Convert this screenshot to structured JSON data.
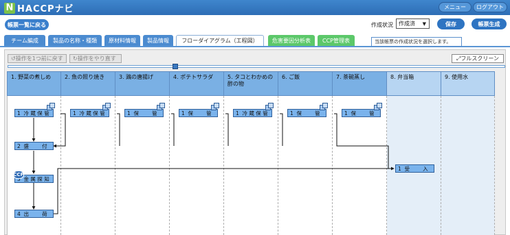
{
  "header": {
    "logo_mark": "N",
    "logo_text": "HACCPナビ",
    "menu_label": "メニュー",
    "logout_label": "ログアウト"
  },
  "subbar": {
    "back_label": "帳票一覧に戻る",
    "status_label": "作成状況",
    "status_value": "作成済",
    "save_label": "保存",
    "generate_label": "帳票生成",
    "tooltip": "当該帳票の作成状況を選択します。"
  },
  "tabs": [
    {
      "label": "チーム編成"
    },
    {
      "label": "製品の名称・種類"
    },
    {
      "label": "原材料情報"
    },
    {
      "label": "製品情報"
    },
    {
      "label": "フローダイアグラム（工程図）"
    },
    {
      "label": "危害要因分析表"
    },
    {
      "label": "CCP管理表"
    }
  ],
  "toolbar": {
    "undo_label": "操作を1つ前に戻す",
    "redo_label": "操作をやり直す",
    "fullscreen_label": "フルスクリーン"
  },
  "columns": [
    {
      "label": "1. 野菜の煮しめ"
    },
    {
      "label": "2. 魚の照り焼き"
    },
    {
      "label": "3. 鶏の唐揚げ"
    },
    {
      "label": "4. ポテトサラダ"
    },
    {
      "label": "5. タコとわかめの酢の物"
    },
    {
      "label": "6. ご飯"
    },
    {
      "label": "7. 茶碗蒸し"
    },
    {
      "label": "8. 弁当箱"
    },
    {
      "label": "9. 使用水"
    }
  ],
  "nodes": {
    "c1_storage": "1  冷 蔵 保 管",
    "c2_storage": "1  冷 蔵 保 管",
    "c3_storage": "1  保        管",
    "c4_storage": "1  保        管",
    "c5_storage": "1  冷 蔵 保 管",
    "c6_storage": "1  保        管",
    "c7_storage": "1  保        管",
    "c1_fill": "2  盛        付",
    "c1_metal": "3  金 属 探 知",
    "c1_ship": "4  出        荷",
    "c8_receive": "1  受        入"
  },
  "ccp_badge": "CCP",
  "colors": {
    "header": "#2d6db5",
    "column_dark": "#7ab0e4",
    "column_light": "#b7d5f2",
    "node": "#7ab3ec",
    "green_tab": "#5cc86a"
  }
}
